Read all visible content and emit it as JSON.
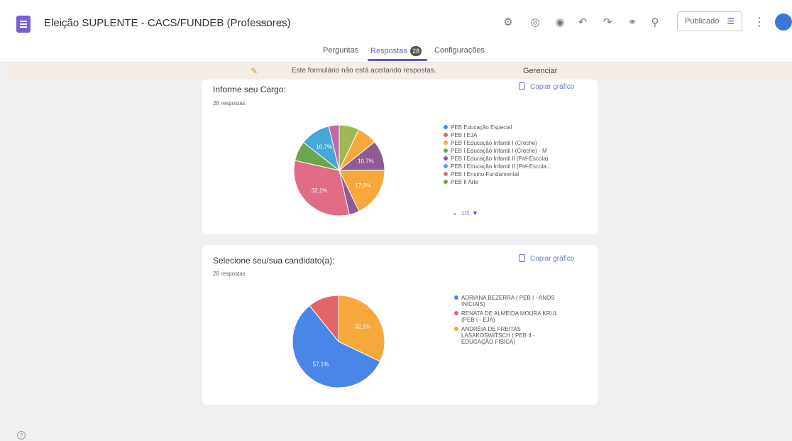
{
  "header": {
    "title": "Eleição SUPLENTE - CACS/FUNDEB (Professores)",
    "folder_icon": "▭",
    "star_icon": "☆",
    "tool_icons": [
      "⚙",
      "◎",
      "◉",
      "↶",
      "↷",
      "⚭",
      "⚲"
    ],
    "publish_label": "Publicado",
    "more_icon": "⋮"
  },
  "tabs": {
    "questions": "Perguntas",
    "responses": "Respostas",
    "responses_count": "28",
    "settings": "Configurações"
  },
  "banner": {
    "text": "Este formulário não está aceitando respostas.",
    "link": "Gerenciar"
  },
  "colors": {
    "blue": "#4a86e8",
    "red": "#e06666",
    "orange": "#f6a83a",
    "green": "#6aa84f",
    "purple": "#8e5b94",
    "teal": "#46a8d8",
    "pink": "#e06c86",
    "olive": "#9fb84f"
  },
  "charts": [
    {
      "question": "Informe seu Cargo:",
      "count": "28 respostas",
      "copy_label": "Copiar gráfico",
      "pager": "1/3",
      "chart_data": {
        "type": "pie",
        "slice_labels": [
          "10,7%",
          "10,7%",
          "17,9%",
          "32,1%"
        ],
        "slices": [
          {
            "value": 7.1,
            "color": "#9fb84f"
          },
          {
            "value": 7.1,
            "color": "#f6a83a"
          },
          {
            "value": 10.7,
            "color": "#8e5b94",
            "label": "10,7%"
          },
          {
            "value": 17.9,
            "color": "#f6a83a",
            "label": "17,9%"
          },
          {
            "value": 3.6,
            "color": "#8e5b94"
          },
          {
            "value": 32.1,
            "color": "#e06c86",
            "label": "32,1%"
          },
          {
            "value": 7.1,
            "color": "#6aa84f"
          },
          {
            "value": 10.7,
            "color": "#46a8d8",
            "label": "10,7%"
          },
          {
            "value": 3.7,
            "color": "#c06aa8"
          }
        ],
        "legend": [
          {
            "label": "PEB Educação Especial",
            "color": "#4a86e8"
          },
          {
            "label": "PEB I EJA",
            "color": "#e06666"
          },
          {
            "label": "PEB I Educação Infantil I (Creche)",
            "color": "#f6a83a"
          },
          {
            "label": "PEB I Educação Infantil I (Creche) - M",
            "color": "#6aa84f"
          },
          {
            "label": "PEB I Educação Infantil II (Pré-Escola)",
            "color": "#8e5b94"
          },
          {
            "label": "PEB I Educação Infantil II (Pré-Escola...",
            "color": "#46a8d8"
          },
          {
            "label": "PEB I Ensino Fundamental",
            "color": "#e06c86"
          },
          {
            "label": "PEB II Arte",
            "color": "#6aa84f"
          }
        ]
      }
    },
    {
      "question": "Selecione seu/sua candidato(a):",
      "count": "28 respostas",
      "copy_label": "Copiar gráfico",
      "chart_data": {
        "type": "pie",
        "slice_labels": [
          "32,1%",
          "57,1%"
        ],
        "slices": [
          {
            "value": 32.1,
            "color": "#f6a83a",
            "label": "32,1%"
          },
          {
            "value": 57.1,
            "color": "#4a86e8",
            "label": "57,1%"
          },
          {
            "value": 10.8,
            "color": "#e06666"
          }
        ],
        "legend": [
          {
            "label": "ADRIANA BEZERRA ( PEB I - ANOS INICIAIS)",
            "color": "#4a86e8"
          },
          {
            "label": "RENATA DE ALMEIDA MOURA KRUL (PEB I - EJA)",
            "color": "#e06666"
          },
          {
            "label": "ANDRÉIA DE FREITAS LASAKOSWITSCH ( PEB II - EDUCAÇÃO FÍSICA)",
            "color": "#f6a83a"
          }
        ]
      }
    }
  ]
}
